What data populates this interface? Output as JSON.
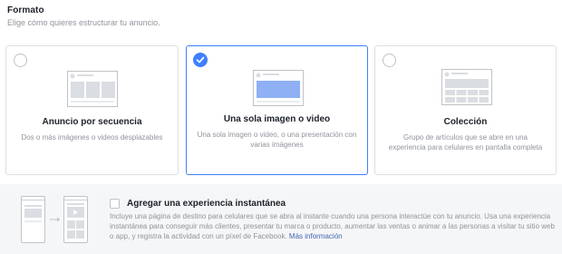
{
  "section": {
    "title": "Formato",
    "subtitle": "Elige cómo quieres estructurar tu anuncio."
  },
  "formats": [
    {
      "label": "Anuncio por secuencia",
      "description": "Dos o más imágenes o videos desplazables",
      "selected": false,
      "thumbnail_icon": "carousel-thumbnail-icon"
    },
    {
      "label": "Una sola imagen o video",
      "description": "Una sola imagen o video, o una presentación con varias imágenes",
      "selected": true,
      "thumbnail_icon": "single-image-thumbnail-icon"
    },
    {
      "label": "Colección",
      "description": "Grupo de artículos que se abre en una experiencia para celulares en pantalla completa",
      "selected": false,
      "thumbnail_icon": "collection-thumbnail-icon"
    }
  ],
  "instant_experience": {
    "checkbox_label": "Agregar una experiencia instantánea",
    "checked": false,
    "description": "Incluye una página de destino para celulares que se abra al instante cuando una persona interactúe con tu anuncio. Usa una experiencia instantánea para conseguir más clientes, presentar tu marca o producto, aumentar las ventas o animar a las personas a visitar tu sitio web o app, y registra la actividad con un píxel de Facebook.",
    "link_text": "Más información",
    "illustration_icon": "instant-experience-phones-icon"
  },
  "colors": {
    "accent": "#4080ff",
    "link": "#4267b2",
    "text": "#1d2129",
    "muted": "#90949c",
    "border": "#dddfe2"
  }
}
